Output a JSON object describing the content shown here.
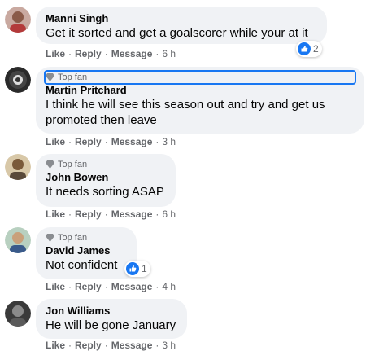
{
  "comments": [
    {
      "name": "Manni Singh",
      "badge": "",
      "text_lines": [
        "Get it sorted and get a goalscorer while your at it"
      ],
      "actions": {
        "like": "Like",
        "reply": "Reply",
        "message": "Message",
        "time": "6 h"
      },
      "reaction_count": "2"
    },
    {
      "name": "Martin Pritchard",
      "badge": "Top fan",
      "text_lines": [
        "I think he will see this season out and try and get us",
        "promoted then leave"
      ],
      "actions": {
        "like": "Like",
        "reply": "Reply",
        "message": "Message",
        "time": "3 h"
      },
      "reaction_count": ""
    },
    {
      "name": "John Bowen",
      "badge": "Top fan",
      "text_lines": [
        "It needs sorting ASAP"
      ],
      "actions": {
        "like": "Like",
        "reply": "Reply",
        "message": "Message",
        "time": "6 h"
      },
      "reaction_count": ""
    },
    {
      "name": "David James",
      "badge": "Top fan",
      "text_lines": [
        "Not confident"
      ],
      "actions": {
        "like": "Like",
        "reply": "Reply",
        "message": "Message",
        "time": "4 h"
      },
      "reaction_count": "1"
    },
    {
      "name": "Jon Williams",
      "badge": "",
      "text_lines": [
        "He will be gone January"
      ],
      "actions": {
        "like": "Like",
        "reply": "Reply",
        "message": "Message",
        "time": "3 h"
      },
      "reaction_count": ""
    }
  ],
  "colors": {
    "accent": "#1877f2",
    "bubble": "#f0f2f5",
    "secondary_text": "#65676b"
  },
  "icons": {
    "reaction": "like-thumb-icon",
    "badge": "diamond-icon"
  }
}
